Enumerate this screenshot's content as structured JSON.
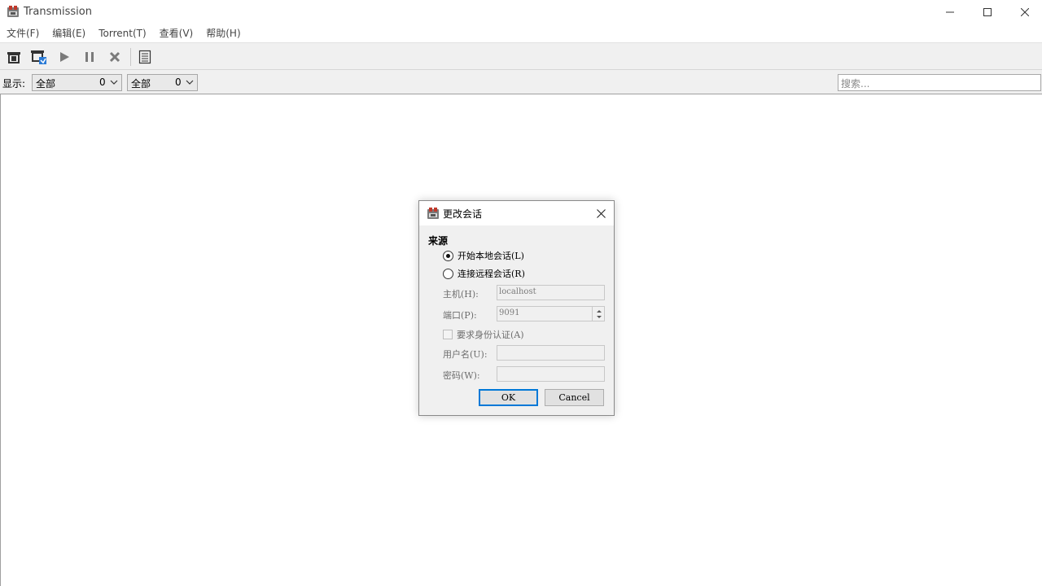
{
  "window": {
    "title": "Transmission"
  },
  "menu": [
    "文件(F)",
    "编辑(E)",
    "Torrent(T)",
    "查看(V)",
    "帮助(H)"
  ],
  "toolbar": {
    "buttons": [
      "open-torrent-icon",
      "open-url-icon",
      "start-icon",
      "pause-icon",
      "remove-icon",
      "properties-icon"
    ]
  },
  "filter": {
    "label": "显示:",
    "status": {
      "text": "全部",
      "count": "0"
    },
    "tracker": {
      "text": "全部",
      "count": "0"
    },
    "search_placeholder": "搜索..."
  },
  "dialog": {
    "title": "更改会话",
    "section": "来源",
    "local_label": "开始本地会话(L)",
    "remote_label": "连接远程会话(R)",
    "selected": "local",
    "host_label": "主机(H):",
    "host_value": "localhost",
    "port_label": "端口(P):",
    "port_value": "9091",
    "auth_label": "要求身份认证(A)",
    "auth_checked": false,
    "user_label": "用户名(U):",
    "user_value": "",
    "pass_label": "密码(W):",
    "pass_value": "",
    "ok_label": "OK",
    "cancel_label": "Cancel"
  },
  "colors": {
    "accent": "#0078d7",
    "toolbar_bg": "#f0f0f0",
    "icon_dark": "#333333",
    "icon_gray": "#7a7a7a"
  }
}
